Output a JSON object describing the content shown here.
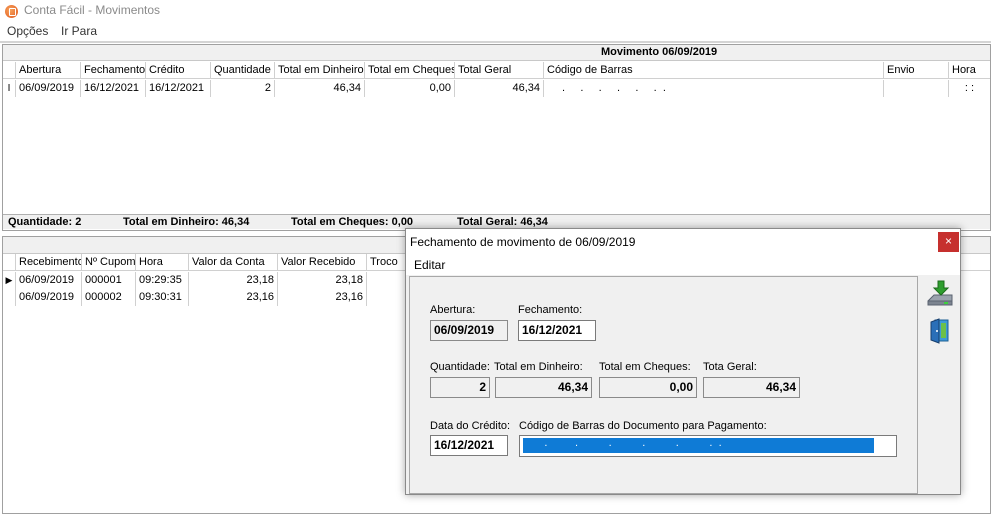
{
  "window": {
    "title": "Conta Fácil - Movimentos"
  },
  "menu": {
    "opcoes": "Opções",
    "ir_para": "Ir Para"
  },
  "movimento": {
    "caption": "Movimento 06/09/2019",
    "columns": [
      "Abertura",
      "Fechamento",
      "Crédito",
      "Quantidade",
      "Total em Dinheiro",
      "Total em Cheques",
      "Total Geral",
      "Código de Barras",
      "Envio",
      "Hora"
    ],
    "rows": [
      [
        "06/09/2019",
        "16/12/2021",
        "16/12/2021",
        "2",
        "46,34",
        "0,00",
        "46,34",
        ".     .     .     .     .     .  .",
        "",
        ":  :"
      ]
    ],
    "indicator": "I"
  },
  "summary": {
    "quantidade": "Quantidade: 2",
    "dinheiro": "Total em Dinheiro: 46,34",
    "cheques": "Total em Cheques: 0,00",
    "geral": "Total Geral: 46,34"
  },
  "cupons": {
    "columns": [
      "Recebimento",
      "Nº Cupom",
      "Hora",
      "Valor da Conta",
      "Valor Recebido",
      "Troco"
    ],
    "rows": [
      [
        "06/09/2019",
        "000001",
        "09:29:35",
        "23,18",
        "23,18",
        ""
      ],
      [
        "06/09/2019",
        "000002",
        "09:30:31",
        "23,16",
        "23,16",
        ""
      ]
    ],
    "current_indicator": "▶"
  },
  "dialog": {
    "title": "Fechamento de movimento de 06/09/2019",
    "close": "×",
    "menu_editar": "Editar",
    "abertura_label": "Abertura:",
    "abertura_value": "06/09/2019",
    "fechamento_label": "Fechamento:",
    "fechamento_value": "16/12/2021",
    "quantidade_label": "Quantidade:",
    "quantidade_value": "2",
    "dinheiro_label": "Total em Dinheiro:",
    "dinheiro_value": "46,34",
    "cheques_label": "Total em Cheques:",
    "cheques_value": "0,00",
    "geral_label": "Tota Geral:",
    "geral_value": "46,34",
    "credito_label": "Data do Crédito:",
    "credito_value": "16/12/2021",
    "barcode_label": "Código de Barras do Documento para Pagamento:",
    "barcode_value": "       .         .          .          .          .          .  .",
    "icons": {
      "save": "save-icon",
      "exit": "exit-door-icon"
    }
  },
  "colors": {
    "close_red": "#c6302e",
    "barcode_blue": "#0f7bd6",
    "arrow_green": "#2e9e2e"
  }
}
